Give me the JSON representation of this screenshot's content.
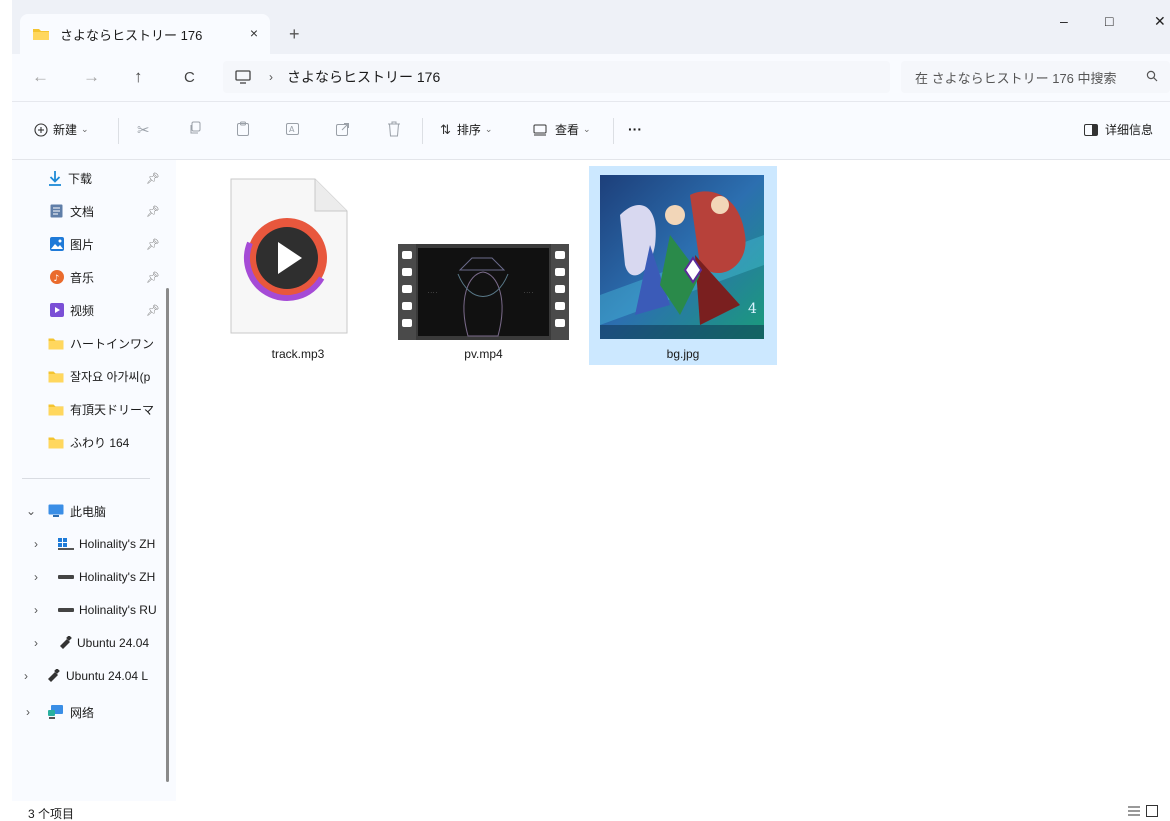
{
  "tab": {
    "title": "さよならヒストリー 176",
    "close": "×",
    "new_tab": "+"
  },
  "window": {
    "minimize": "–",
    "maximize": "□",
    "close": "✕"
  },
  "nav": {
    "back": "←",
    "forward": "→",
    "up": "↑",
    "refresh": "C",
    "breadcrumb_sep": "›",
    "breadcrumb": "さよならヒストリー 176",
    "search_placeholder": "在 さよならヒストリー 176 中搜索"
  },
  "toolbar": {
    "new_label": "新建",
    "sort_label": "排序",
    "view_label": "查看",
    "more_label": "···",
    "details_label": "详细信息"
  },
  "sidebar": {
    "quick_access": [
      {
        "label": "下载",
        "icon": "download-icon",
        "pinned": true
      },
      {
        "label": "文档",
        "icon": "document-icon",
        "pinned": true
      },
      {
        "label": "图片",
        "icon": "pictures-icon",
        "pinned": true
      },
      {
        "label": "音乐",
        "icon": "music-icon",
        "pinned": true
      },
      {
        "label": "视频",
        "icon": "video-icon",
        "pinned": true
      },
      {
        "label": "ハートインワン",
        "icon": "folder-icon"
      },
      {
        "label": "잘자요 아가씨(p",
        "icon": "folder-icon"
      },
      {
        "label": "有頂天ドリーマ",
        "icon": "folder-icon"
      },
      {
        "label": "ふわり 164",
        "icon": "folder-icon"
      }
    ],
    "this_pc": "此电脑",
    "drives": [
      {
        "label": "Holinality's ZH",
        "icon": "windows-drive-icon"
      },
      {
        "label": "Holinality's ZH",
        "icon": "drive-icon"
      },
      {
        "label": "Holinality's RU",
        "icon": "drive-icon"
      },
      {
        "label": "Ubuntu 24.04",
        "icon": "usb-icon"
      }
    ],
    "ubuntu_root": "Ubuntu 24.04 L",
    "network": "网络"
  },
  "files": [
    {
      "name": "track.mp3",
      "type": "audio"
    },
    {
      "name": "pv.mp4",
      "type": "video"
    },
    {
      "name": "bg.jpg",
      "type": "image",
      "selected": true
    }
  ],
  "status": {
    "item_count": "3 个项目"
  },
  "colors": {
    "accent": "#0067c0",
    "folder": "#f4c430",
    "selection": "#cce8ff"
  }
}
